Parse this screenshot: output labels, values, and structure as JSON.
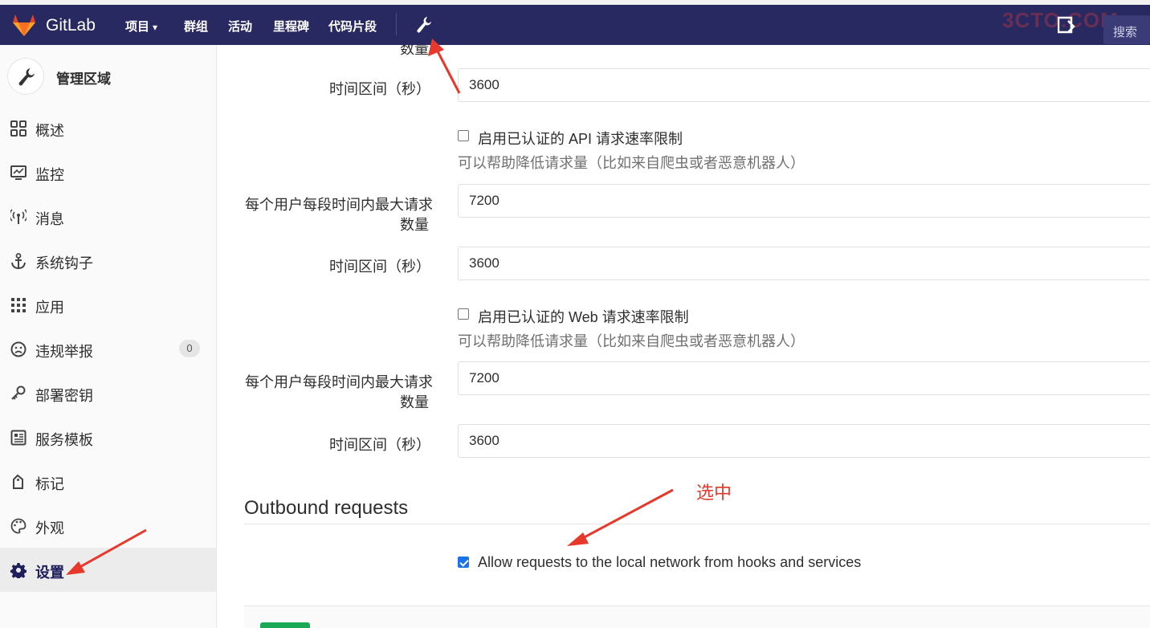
{
  "navbar": {
    "brand": "GitLab",
    "items": [
      {
        "label": "项目",
        "dropdown": true
      },
      {
        "label": "群组"
      },
      {
        "label": "活动"
      },
      {
        "label": "里程碑"
      },
      {
        "label": "代码片段"
      }
    ],
    "search_label": "搜索",
    "watermark": "3CTO.COM",
    "bg_color": "#292961"
  },
  "sidebar": {
    "title": "管理区域",
    "items": [
      {
        "label": "概述",
        "icon": "overview-grid-icon"
      },
      {
        "label": "监控",
        "icon": "monitor-icon"
      },
      {
        "label": "消息",
        "icon": "broadcast-icon"
      },
      {
        "label": "系统钩子",
        "icon": "anchor-icon"
      },
      {
        "label": "应用",
        "icon": "apps-grid-icon"
      },
      {
        "label": "违规举报",
        "icon": "frown-icon",
        "badge": "0"
      },
      {
        "label": "部署密钥",
        "icon": "key-icon"
      },
      {
        "label": "服务模板",
        "icon": "template-icon"
      },
      {
        "label": "标记",
        "icon": "label-icon"
      },
      {
        "label": "外观",
        "icon": "palette-icon"
      },
      {
        "label": "设置",
        "icon": "gear-icon",
        "active": true
      }
    ]
  },
  "form": {
    "partial_label": "数量",
    "period_label": "时间区间（秒）",
    "max_label_line1": "每个用户每段时间内最大请求",
    "max_label_line2": "数量",
    "period1_value": "3600",
    "api_limit": {
      "label": "启用已认证的 API 请求速率限制",
      "checked": false,
      "help": "可以帮助降低请求量（比如来自爬虫或者恶意机器人）",
      "max_value": "7200",
      "period_value": "3600"
    },
    "web_limit": {
      "label": "启用已认证的 Web 请求速率限制",
      "checked": false,
      "help": "可以帮助降低请求量（比如来自爬虫或者恶意机器人）",
      "max_value": "7200",
      "period_value": "3600"
    }
  },
  "outbound": {
    "title": "Outbound requests",
    "allow_local_label": "Allow requests to the local network from hooks and services",
    "allow_local_checked": true
  },
  "annotation": {
    "text": "选中",
    "color": "#e8382c"
  }
}
